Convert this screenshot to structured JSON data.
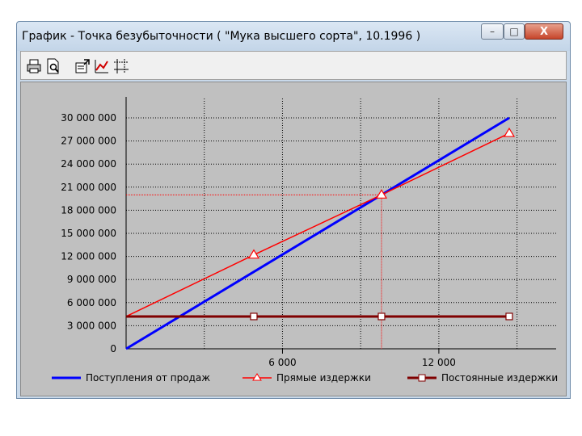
{
  "window": {
    "title": "График - Точка безубыточности ( \"Мука высшего сорта\", 10.1996 )",
    "controls": {
      "minimize": "–",
      "maximize": "□",
      "close": "X"
    }
  },
  "toolbar": {
    "buttons": [
      "print-icon",
      "print-preview-icon",
      "chart-properties-icon",
      "chart-type-icon",
      "gridlines-icon"
    ]
  },
  "chart_data": {
    "type": "line",
    "title": "",
    "xlabel": "",
    "ylabel": "",
    "xlim": [
      0,
      16500
    ],
    "ylim": [
      0,
      30000000
    ],
    "grid": true,
    "legend_position": "bottom",
    "x_ticks": [
      6000,
      12000
    ],
    "x_tick_labels": [
      "6 000",
      "12 000"
    ],
    "y_ticks": [
      0,
      3000000,
      6000000,
      9000000,
      12000000,
      15000000,
      18000000,
      21000000,
      24000000,
      27000000,
      30000000
    ],
    "y_tick_labels": [
      "0",
      "3  000  000",
      "6  000  000",
      "9  000  000",
      "12  000  000",
      "15  000  000",
      "18  000  000",
      "21  000  000",
      "24  000  000",
      "27  000  000",
      "30  000  000"
    ],
    "series": [
      {
        "name": "Поступления от продаж",
        "color": "#0000ff",
        "marker": "none",
        "x": [
          0,
          14700
        ],
        "y": [
          0,
          30000000
        ]
      },
      {
        "name": "Прямые издержки",
        "color": "#ff0000",
        "marker": "triangle",
        "x": [
          0,
          4900,
          9800,
          14700
        ],
        "y": [
          4200000,
          12200000,
          20000000,
          28000000
        ]
      },
      {
        "name": "Постоянные издержки",
        "color": "#800000",
        "marker": "square",
        "x": [
          0,
          4900,
          9800,
          14700
        ],
        "y": [
          4200000,
          4200000,
          4200000,
          4200000
        ]
      }
    ],
    "annotations": {
      "breakeven_x": 9800,
      "breakeven_y": 20000000,
      "breakeven_color": "#ff0000"
    }
  }
}
